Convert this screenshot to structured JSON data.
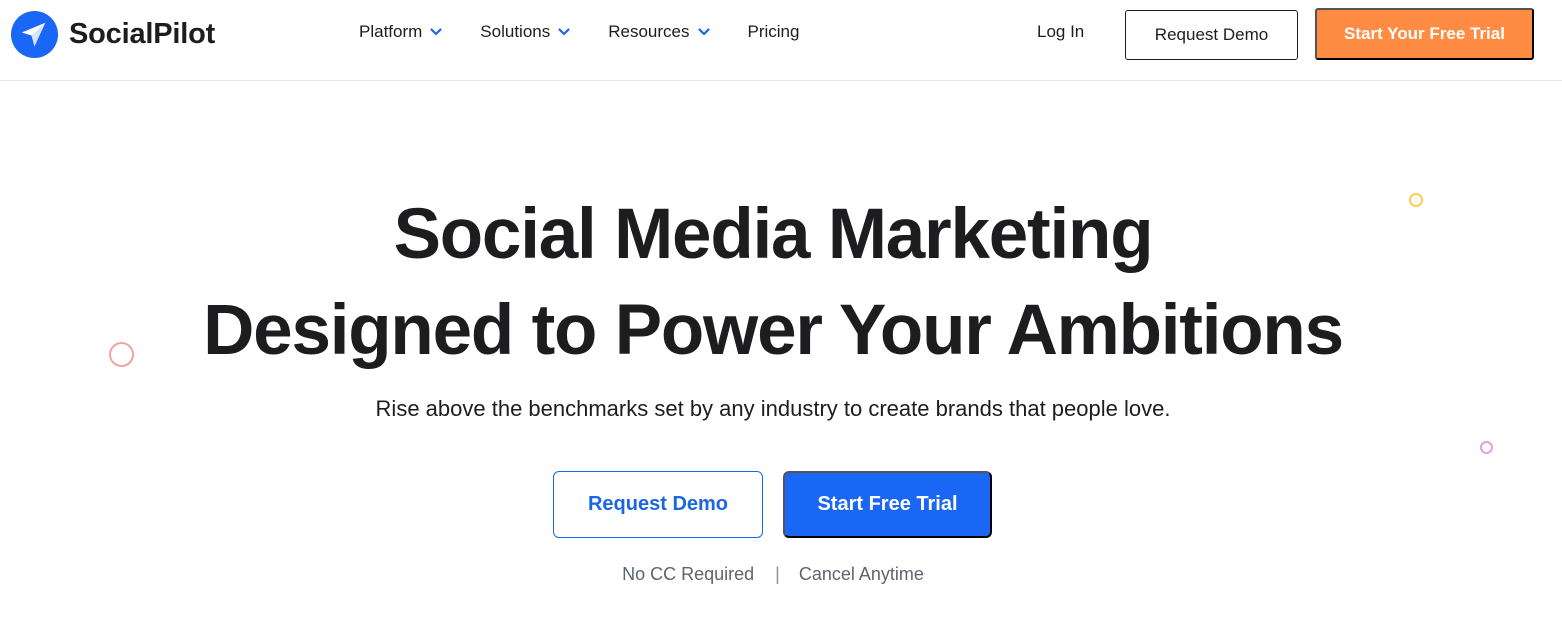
{
  "header": {
    "brand": "SocialPilot",
    "nav": [
      {
        "label": "Platform",
        "has_dropdown": true
      },
      {
        "label": "Solutions",
        "has_dropdown": true
      },
      {
        "label": "Resources",
        "has_dropdown": true
      },
      {
        "label": "Pricing",
        "has_dropdown": false
      }
    ],
    "login_label": "Log In",
    "request_demo_label": "Request Demo",
    "free_trial_label": "Start Your Free Trial"
  },
  "hero": {
    "title_line1": "Social Media Marketing",
    "title_line2": "Designed to Power Your Ambitions",
    "subtitle": "Rise above the benchmarks set by any industry to create brands that people love.",
    "request_demo_label": "Request Demo",
    "free_trial_label": "Start Free Trial",
    "note_left": "No CC Required",
    "note_separator": "|",
    "note_right": "Cancel Anytime"
  },
  "colors": {
    "brand_blue": "#1a66f5",
    "accent_orange": "#ff8c42",
    "text_dark": "#1d1d1f",
    "text_muted": "#5e6470"
  },
  "icons": {
    "logo": "paper-plane-logo-icon",
    "dropdown": "chevron-down-icon"
  }
}
